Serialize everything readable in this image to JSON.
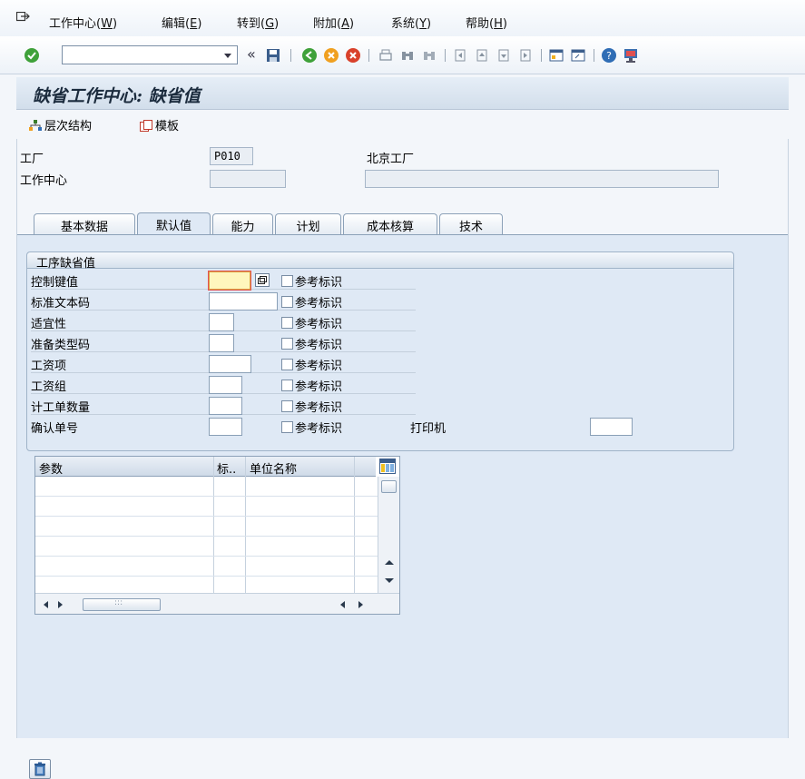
{
  "menu": {
    "items": [
      {
        "label": "工作中心",
        "accel": "W"
      },
      {
        "label": "编辑",
        "accel": "E"
      },
      {
        "label": "转到",
        "accel": "G"
      },
      {
        "label": "附加",
        "accel": "A"
      },
      {
        "label": "系统",
        "accel": "Y"
      },
      {
        "label": "帮助",
        "accel": "H"
      }
    ]
  },
  "toolbar": {
    "command_value": ""
  },
  "title": "缺省工作中心: 缺省值",
  "app_toolbar": {
    "hierarchy_label": "层次结构",
    "template_label": "模板"
  },
  "header": {
    "plant_label": "工厂",
    "plant_value": "P010",
    "plant_name": "北京工厂",
    "workcenter_label": "工作中心",
    "workcenter_value": "",
    "workcenter_desc": ""
  },
  "tabs": [
    {
      "label": "基本数据",
      "active": false
    },
    {
      "label": "默认值",
      "active": true
    },
    {
      "label": "能力",
      "active": false
    },
    {
      "label": "计划",
      "active": false
    },
    {
      "label": "成本核算",
      "active": false
    },
    {
      "label": "技术",
      "active": false
    }
  ],
  "group": {
    "title": "工序缺省值",
    "rows": [
      {
        "label": "控制键值",
        "value": "",
        "ref_label": "参考标识",
        "ref_checked": false
      },
      {
        "label": "标准文本码",
        "value": "",
        "ref_label": "参考标识",
        "ref_checked": false
      },
      {
        "label": "适宜性",
        "value": "",
        "ref_label": "参考标识",
        "ref_checked": false
      },
      {
        "label": "准备类型码",
        "value": "",
        "ref_label": "参考标识",
        "ref_checked": false
      },
      {
        "label": "工资项",
        "value": "",
        "ref_label": "参考标识",
        "ref_checked": false
      },
      {
        "label": "工资组",
        "value": "",
        "ref_label": "参考标识",
        "ref_checked": false
      },
      {
        "label": "计工单数量",
        "value": "",
        "ref_label": "参考标识",
        "ref_checked": false
      },
      {
        "label": "确认单号",
        "value": "",
        "ref_label": "参考标识",
        "ref_checked": false
      }
    ],
    "printer_label": "打印机",
    "printer_value": ""
  },
  "table": {
    "columns": [
      "参数",
      "标..",
      "单位名称"
    ],
    "rows": [
      [
        "",
        "",
        ""
      ],
      [
        "",
        "",
        ""
      ],
      [
        "",
        "",
        ""
      ],
      [
        "",
        "",
        ""
      ],
      [
        "",
        "",
        ""
      ],
      [
        "",
        "",
        ""
      ]
    ],
    "hscroll_grip": ":::"
  },
  "colors": {
    "accent": "#1b2b3d",
    "panel": "#dfe9f5",
    "focus_fill": "#fff6bd"
  }
}
